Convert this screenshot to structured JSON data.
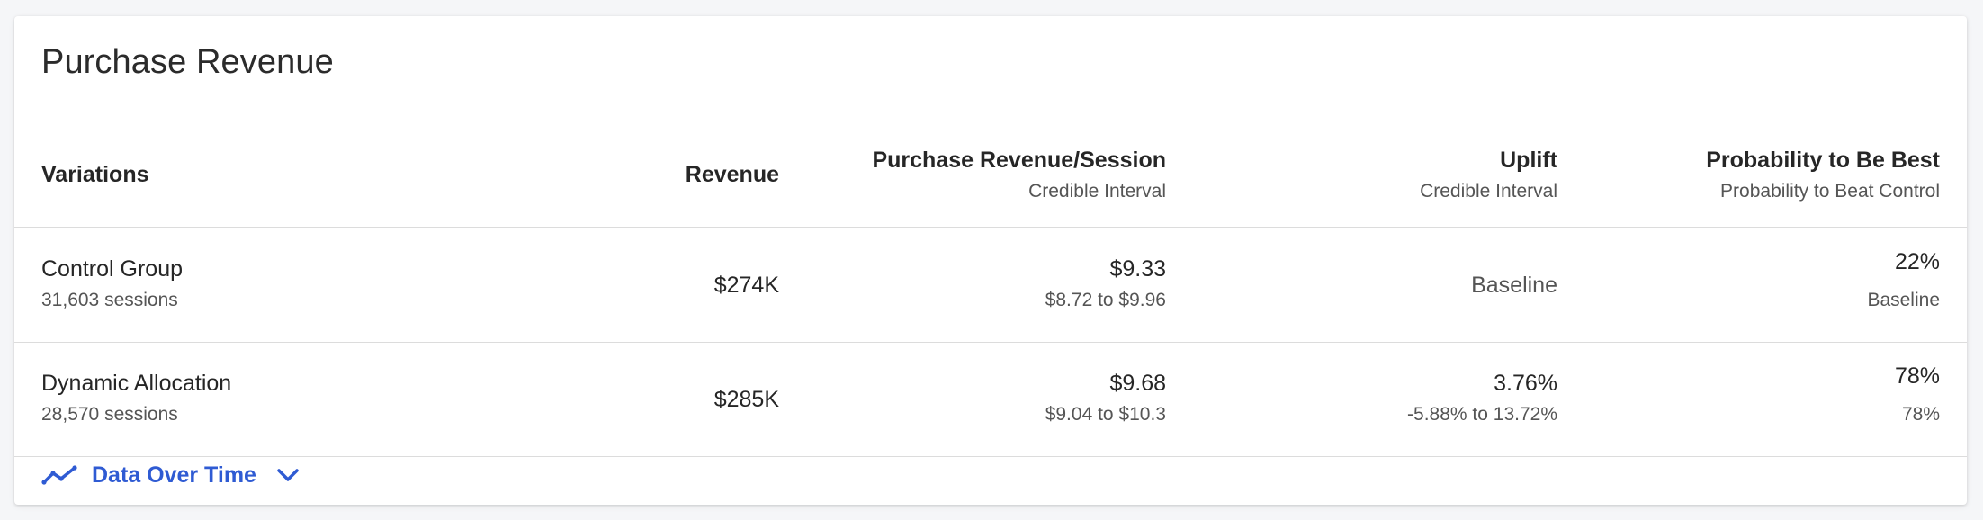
{
  "card": {
    "title": "Purchase Revenue"
  },
  "columns": {
    "variations": "Variations",
    "revenue": "Revenue",
    "rps": {
      "title": "Purchase Revenue/Session",
      "subtitle": "Credible Interval"
    },
    "uplift": {
      "title": "Uplift",
      "subtitle": "Credible Interval"
    },
    "prob_best": {
      "title": "Probability to Be Best",
      "subtitle": "Probability to Beat Control"
    }
  },
  "rows": [
    {
      "name": "Control Group",
      "sessions": "31,603 sessions",
      "revenue": "$274K",
      "rps": "$9.33",
      "rps_interval": "$8.72 to $9.96",
      "uplift": "Baseline",
      "prob_best": "22%",
      "prob_beat": "Baseline"
    },
    {
      "name": "Dynamic Allocation",
      "sessions": "28,570 sessions",
      "revenue": "$285K",
      "rps": "$9.68",
      "rps_interval": "$9.04 to $10.3",
      "uplift": "3.76%",
      "uplift_interval": "-5.88% to 13.72%",
      "prob_best": "78%",
      "prob_beat": "78%"
    }
  ],
  "footer": {
    "label": "Data Over Time",
    "icon": "trend-line-icon",
    "toggle_icon": "chevron-down-icon"
  },
  "colors": {
    "accent": "#2f5bd3",
    "divider": "#dcdcdc",
    "text_primary": "#262626",
    "text_secondary": "#555555"
  }
}
